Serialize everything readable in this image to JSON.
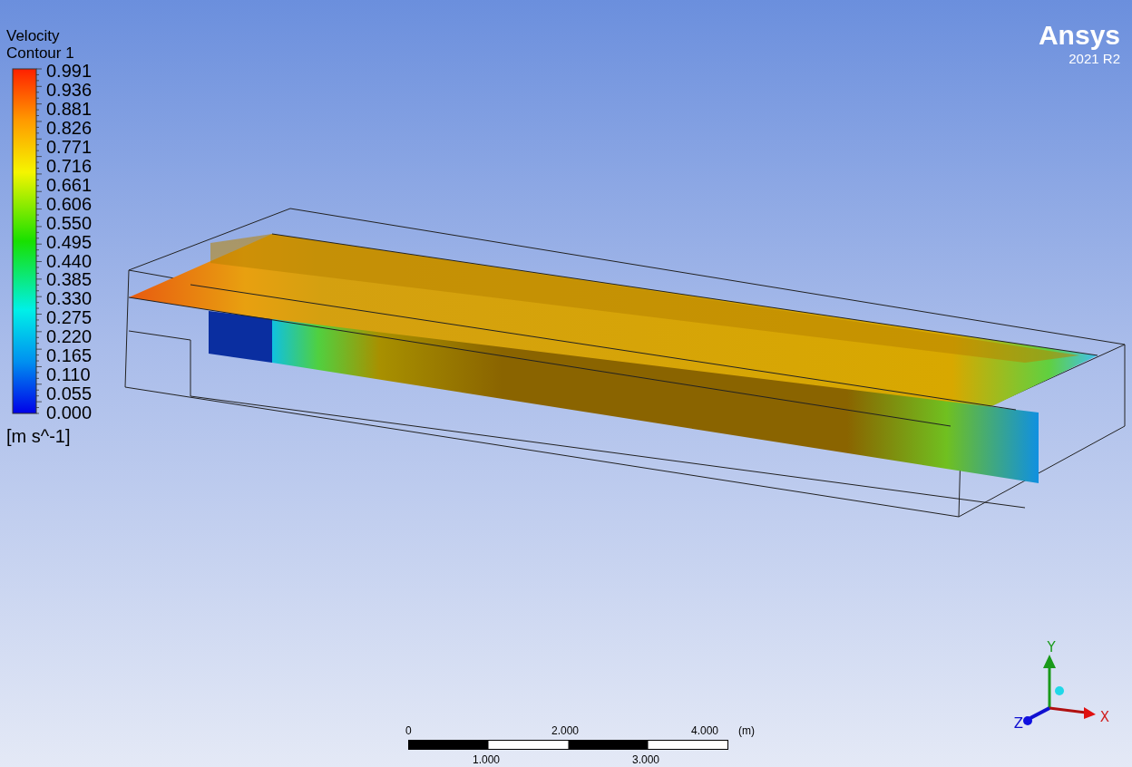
{
  "legend": {
    "title": "Velocity",
    "subtitle": "Contour 1",
    "unit": "[m s^-1]",
    "values": [
      "0.991",
      "0.936",
      "0.881",
      "0.826",
      "0.771",
      "0.716",
      "0.661",
      "0.606",
      "0.550",
      "0.495",
      "0.440",
      "0.385",
      "0.330",
      "0.275",
      "0.220",
      "0.165",
      "0.110",
      "0.055",
      "0.000"
    ]
  },
  "logo": {
    "name": "Ansys",
    "version": "2021 R2"
  },
  "scale_bar": {
    "top_labels": [
      "0",
      "2.000",
      "4.000"
    ],
    "unit": "(m)",
    "bottom_labels": [
      "1.000",
      "3.000"
    ]
  },
  "axes": {
    "x": "X",
    "y": "Y",
    "z": "Z"
  }
}
